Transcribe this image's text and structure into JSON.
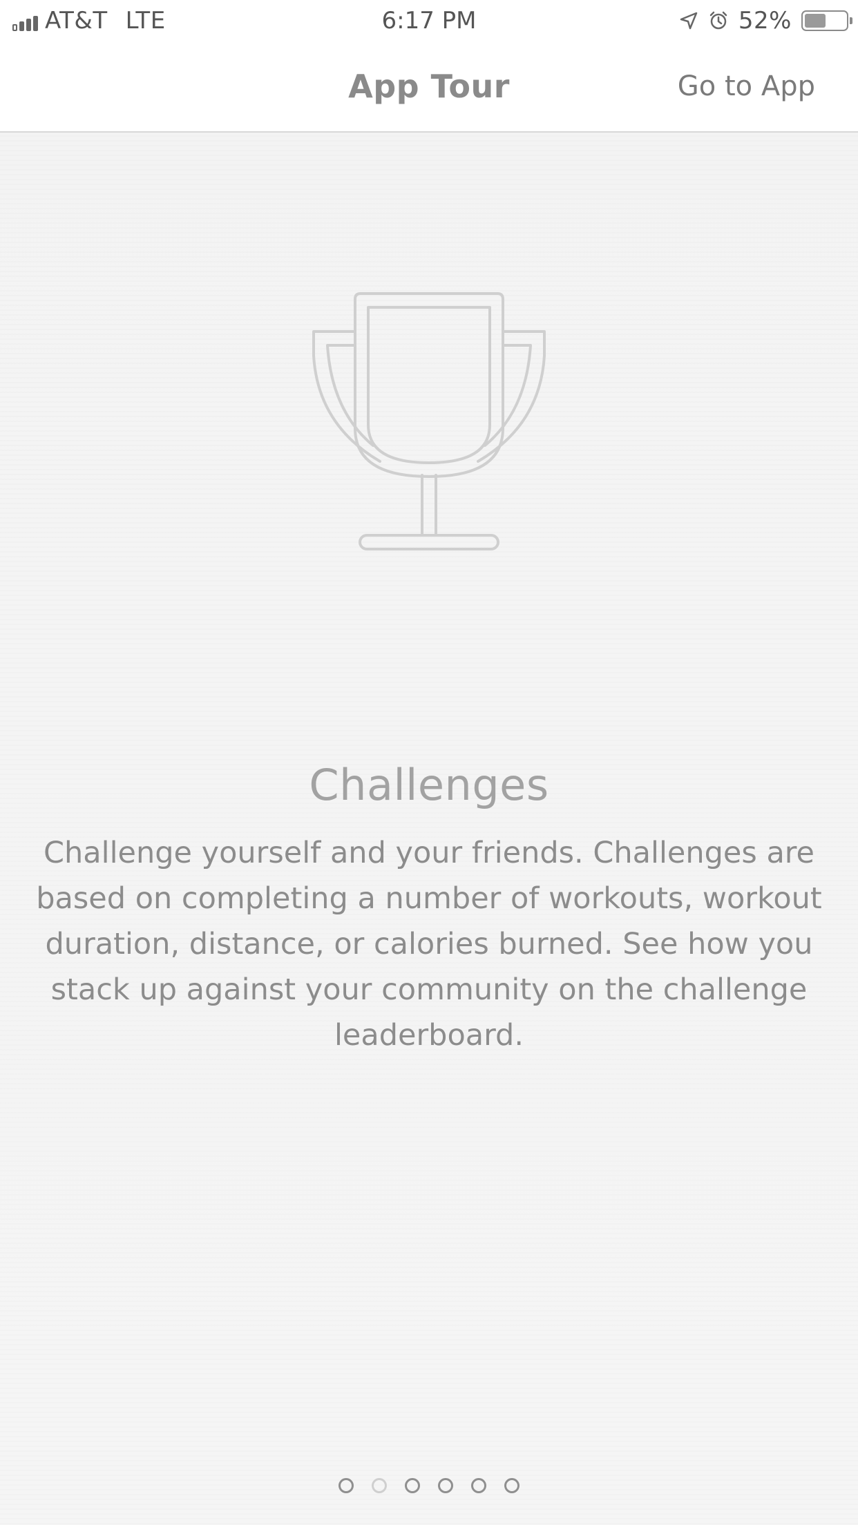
{
  "status_bar": {
    "carrier": "AT&T",
    "network": "LTE",
    "time": "6:17 PM",
    "battery": "52%",
    "battery_level": 0.52
  },
  "nav": {
    "title": "App Tour",
    "action_label": "Go to App"
  },
  "slide": {
    "icon": "trophy-icon",
    "title": "Challenges",
    "description": "Challenge yourself and your friends. Challenges are based on completing a number of workouts, workout duration, distance, or calories burned. See how you stack up against your community on the challenge leaderboard."
  },
  "pagination": {
    "total": 6,
    "current_index": 1
  },
  "colors": {
    "background": "#f4f4f4",
    "text": "#8c8c8c",
    "accent_inactive_dot": "#8f8f8f",
    "active_dot": "#cfcfcf"
  }
}
